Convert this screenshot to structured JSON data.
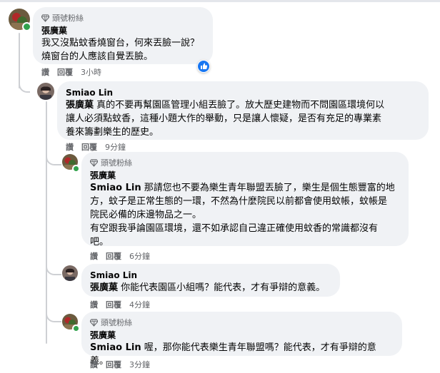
{
  "comments": [
    {
      "badge": "頭號粉絲",
      "author": "張廣菓",
      "lines": [
        "我又沒點蚊香燒窗台，何來丟臉一說？",
        "燒窗台的人應該自覺丟臉。"
      ],
      "actions": {
        "like": "讚",
        "reply": "回覆",
        "time": "3小時"
      },
      "reaction": "like-reaction"
    },
    {
      "author": "Smiao Lin",
      "mention": "張廣菓",
      "lines": [
        " 真的不要再幫園區管理小組丟臉了。放大歷史建物而不問園區環境何以",
        "讓人必須點蚊香，這種小題大作的舉動，只是讓人懷疑，是否有充足的專業素",
        "養來籌劃樂生的歷史。"
      ],
      "actions": {
        "like": "讚",
        "reply": "回覆",
        "time": "9分鐘"
      }
    },
    {
      "badge": "頭號粉絲",
      "author": "張廣菓",
      "mention": "Smiao Lin",
      "lines": [
        " 那請您也不要為樂生青年聯盟丟臉了，樂生是個生態豐富的地",
        "方，蚊子是正常生態的一環，不然為什麼院民以前都會使用蚊帳，蚊帳是",
        "院民必備的床邊物品之一。",
        "有空跟我爭論園區環境，還不如承認自己違正確使用蚊香的常識都沒有",
        "吧。"
      ],
      "actions": {
        "like": "讚",
        "reply": "回覆",
        "time": "6分鐘"
      }
    },
    {
      "author": "Smiao Lin",
      "mention": "張廣菓",
      "lines": [
        " 你能代表園區小組嗎？能代表，才有爭辯的意義。"
      ],
      "actions": {
        "like": "讚",
        "reply": "回覆",
        "time": "4分鐘"
      }
    },
    {
      "badge": "頭號粉絲",
      "author": "張廣菓",
      "mention": "Smiao Lin",
      "lines": [
        " 喔，那你能代表樂生青年聯盟嗎？能代表，才有爭辯的意義。"
      ],
      "actions": {
        "like": "讚",
        "reply": "回覆",
        "time": "3分鐘"
      }
    }
  ],
  "colors": {
    "online": "#31a24c",
    "bubble": "#f0f2f5",
    "like": "#1877f2",
    "meta": "#65676b"
  }
}
